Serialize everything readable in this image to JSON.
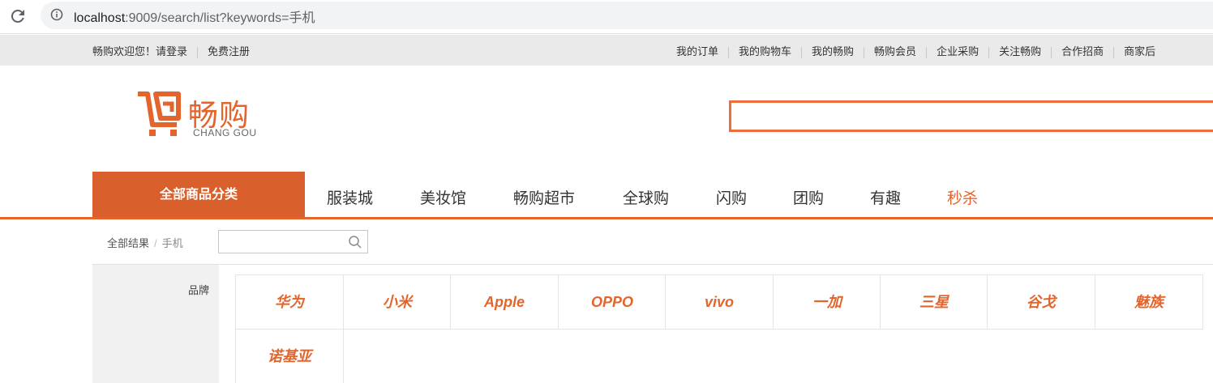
{
  "browser": {
    "url_host": "localhost",
    "url_path": ":9009/search/list?keywords=手机"
  },
  "topbar": {
    "welcome": "畅购欢迎您！",
    "login": "请登录",
    "register": "免费注册",
    "links": [
      "我的订单",
      "我的购物车",
      "我的畅购",
      "畅购会员",
      "企业采购",
      "关注畅购",
      "合作招商",
      "商家后"
    ]
  },
  "header": {
    "logo_text": "畅购",
    "logo_sub": "CHANG GOU",
    "search_value": ""
  },
  "nav": {
    "all_categories": "全部商品分类",
    "items": [
      "服装城",
      "美妆馆",
      "畅购超市",
      "全球购",
      "闪购",
      "团购",
      "有趣",
      "秒杀"
    ]
  },
  "breadcrumb": {
    "all_results": "全部结果",
    "separator": "/",
    "keyword": "手机",
    "filter_placeholder": ""
  },
  "brand_filter": {
    "label": "品牌",
    "brands": [
      "华为",
      "小米",
      "Apple",
      "OPPO",
      "vivo",
      "一加",
      "三星",
      "谷戈",
      "魅族",
      "诺基亚"
    ]
  },
  "colors": {
    "accent": "#e3652c",
    "nav_bg": "#d9602d",
    "search_border": "#ec6f3b"
  }
}
